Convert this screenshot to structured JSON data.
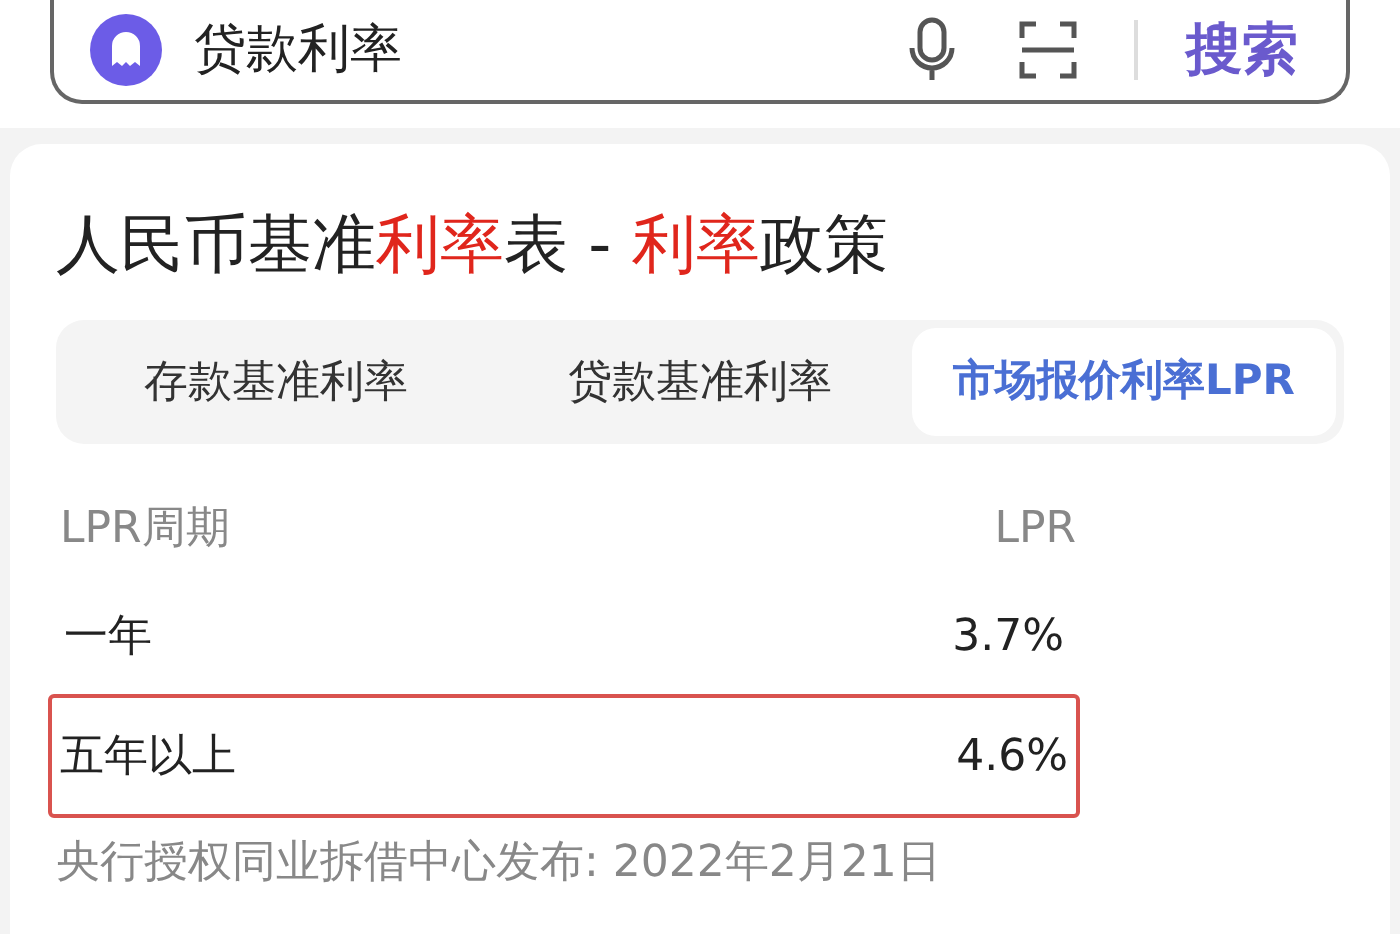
{
  "search": {
    "value": "贷款利率",
    "button": "搜索"
  },
  "card": {
    "title": [
      {
        "text": "人民币基准",
        "highlight": false
      },
      {
        "text": "利率",
        "highlight": true
      },
      {
        "text": "表 - ",
        "highlight": false
      },
      {
        "text": "利率",
        "highlight": true
      },
      {
        "text": "政策",
        "highlight": false
      }
    ],
    "tabs": [
      {
        "label": "存款基准利率",
        "selected": false
      },
      {
        "label": "贷款基准利率",
        "selected": false
      },
      {
        "label": "市场报价利率LPR",
        "selected": true
      }
    ],
    "table": {
      "columns": [
        "LPR周期",
        "LPR"
      ],
      "rows": [
        {
          "cells": [
            "一年",
            "3.7%"
          ],
          "highlighted": false
        },
        {
          "cells": [
            "五年以上",
            "4.6%"
          ],
          "highlighted": true
        }
      ]
    },
    "footnote": "央行授权同业拆借中心发布: 2022年2月21日"
  }
}
